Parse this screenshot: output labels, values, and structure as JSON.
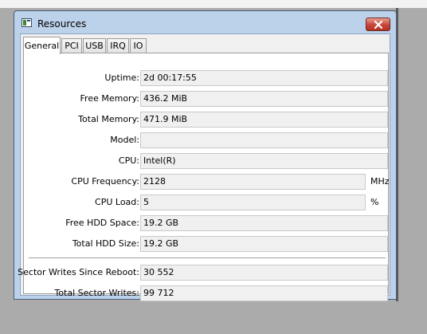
{
  "window": {
    "title": "Resources",
    "close_icon": "close-icon"
  },
  "tabs": [
    {
      "label": "General",
      "active": true
    },
    {
      "label": "PCI"
    },
    {
      "label": "USB"
    },
    {
      "label": "IRQ"
    },
    {
      "label": "IO"
    }
  ],
  "fields": {
    "uptime": {
      "label": "Uptime:",
      "value": "2d 00:17:55"
    },
    "free_memory": {
      "label": "Free Memory:",
      "value": "436.2 MiB"
    },
    "total_memory": {
      "label": "Total Memory:",
      "value": "471.9 MiB"
    },
    "model": {
      "label": "Model:",
      "value": ""
    },
    "cpu": {
      "label": "CPU:",
      "value": "Intel(R)"
    },
    "cpu_frequency": {
      "label": "CPU Frequency:",
      "value": "2128",
      "unit": "MHz"
    },
    "cpu_load": {
      "label": "CPU Load:",
      "value": "5",
      "unit": "%"
    },
    "free_hdd": {
      "label": "Free HDD Space:",
      "value": "19.2 GB"
    },
    "total_hdd": {
      "label": "Total HDD Size:",
      "value": "19.2 GB"
    },
    "sector_writes": {
      "label": "Sector Writes Since Reboot:",
      "value": "30 552"
    },
    "total_sector_writes": {
      "label": "Total Sector Writes:",
      "value": "99 712"
    }
  }
}
